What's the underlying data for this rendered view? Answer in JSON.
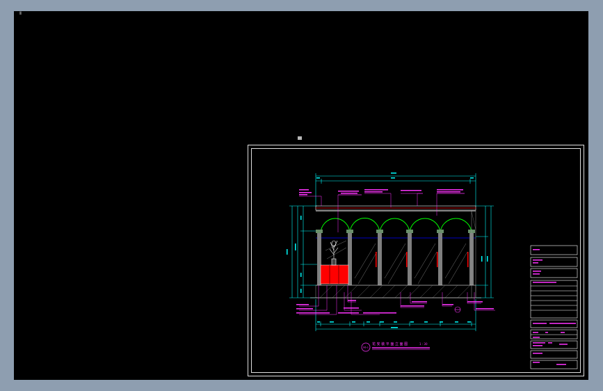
{
  "colors": {
    "background": "#000000",
    "frame": "#e0e0e0",
    "dimension": "#00ffff",
    "annotation": "#ff33ff",
    "arch": "#00ff00",
    "column": "#7f7f7f",
    "fill_red": "#ff0000",
    "beam_line": "#0000ff",
    "hatch": "#aaaaaa"
  },
  "icons": {
    "ucs": "ucs-axis-icon",
    "marker": "sheet-marker-icon"
  },
  "ucs_label": "Ⅱ",
  "drawing": {
    "title_number": "06-1",
    "title": "花  安  装  平  面  立  面  图",
    "scale": "1 : 30"
  }
}
